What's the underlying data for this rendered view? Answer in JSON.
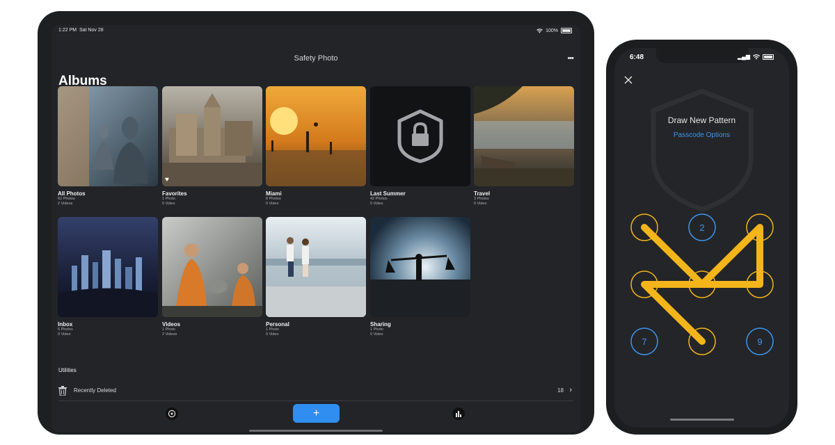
{
  "ipad": {
    "status": {
      "time": "1:22 PM",
      "date": "Sat Nov 28",
      "battery": "100%"
    },
    "nav_title": "Safety Photo",
    "more_icon": "ellipsis-icon",
    "heading": "Albums",
    "albums": [
      {
        "name": "All Photos",
        "line1": "62 Photos",
        "line2": "2 Videos"
      },
      {
        "name": "Favorites",
        "line1": "1 Photo",
        "line2": "0 Video"
      },
      {
        "name": "Miami",
        "line1": "8 Photos",
        "line2": "0 Video"
      },
      {
        "name": "Last Summer",
        "line1": "42 Photos",
        "line2": "0 Video"
      },
      {
        "name": "Travel",
        "line1": "3 Photos",
        "line2": "0 Video"
      },
      {
        "name": "Inbox",
        "line1": "6 Photos",
        "line2": "0 Video"
      },
      {
        "name": "Videos",
        "line1": "1 Photo",
        "line2": "2 Videos"
      },
      {
        "name": "Personal",
        "line1": "1 Photo",
        "line2": "0 Video"
      },
      {
        "name": "Sharing",
        "line1": "1 Photo",
        "line2": "0 Video"
      }
    ],
    "utilities_label": "Utilities",
    "recently_deleted": {
      "label": "Recently Deleted",
      "count": "18"
    },
    "tabbar": {
      "add_label": "+"
    },
    "colors": {
      "accent": "#2f8ef0",
      "background": "#222428"
    }
  },
  "iphone": {
    "time": "6:48",
    "title": "Draw New Pattern",
    "passcode_options": "Passcode Options",
    "dots": [
      "1",
      "2",
      "3",
      "4",
      "5",
      "6",
      "7",
      "8",
      "9"
    ],
    "selected_path": [
      "1",
      "5",
      "3",
      "6",
      "4",
      "8"
    ],
    "colors": {
      "pattern": "#f3b51a",
      "idle_ring": "#3c95f0"
    }
  }
}
